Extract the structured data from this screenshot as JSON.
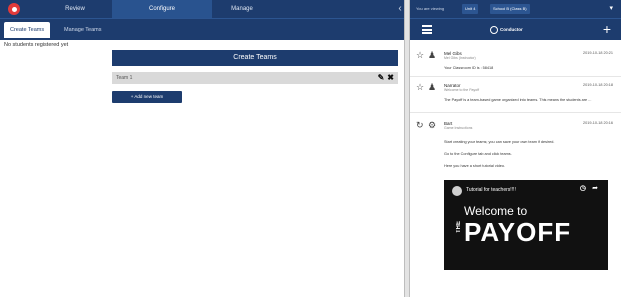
{
  "top_nav": {
    "tabs": [
      {
        "label": "Review"
      },
      {
        "label": "Configure"
      },
      {
        "label": "Manage"
      }
    ],
    "collapse_icon": "chevron-left"
  },
  "sub_nav": {
    "tabs": [
      {
        "label": "Create Teams"
      },
      {
        "label": "Manage Teams"
      }
    ]
  },
  "main": {
    "empty_message": "No students registered yet",
    "create_header": "Create Teams",
    "team_row": {
      "name": "Team 1",
      "edit_icon": "pencil",
      "delete_icon": "close"
    },
    "add_button": "+ Add new team"
  },
  "right_top": {
    "label": "You are viewing",
    "select_1": "Unit 4",
    "select_2": "School B (Class B)",
    "caret_icon": "caret-down"
  },
  "right_bar": {
    "menu_icon": "hamburger",
    "brand": "Conductor",
    "add_icon": "plus"
  },
  "feed": {
    "posts": [
      {
        "name": "Mel Gibs",
        "sub": "Mel Gibs (Instructor)",
        "date": "2019-10-18 20:21",
        "text": "Your Classroom ID is : 58418"
      },
      {
        "name": "Narrator",
        "sub": "Welcome to the Payoff",
        "date": "2019-10-18 20:18",
        "text": "The Payoff is a team-based game organized into teams. This means the students are ..."
      },
      {
        "name": "Bart",
        "sub": "Game Instructions",
        "date": "2019-10-18 20:16",
        "text": "Start creating your teams; you can save your own team if desired.",
        "text2": "Go to the Configure tab and click teams.",
        "text3": "Here you have a short tutorial video."
      }
    ],
    "video": {
      "title": "Tutorial for teachers!!!!",
      "welcome": "Welcome to",
      "the": "THE",
      "logo": "PAYOFF"
    }
  },
  "colors": {
    "navy": "#1d3c6e",
    "navy_light": "#29538f",
    "accent_red": "#e23a3a",
    "team_row_bg": "#d9d9d9"
  }
}
